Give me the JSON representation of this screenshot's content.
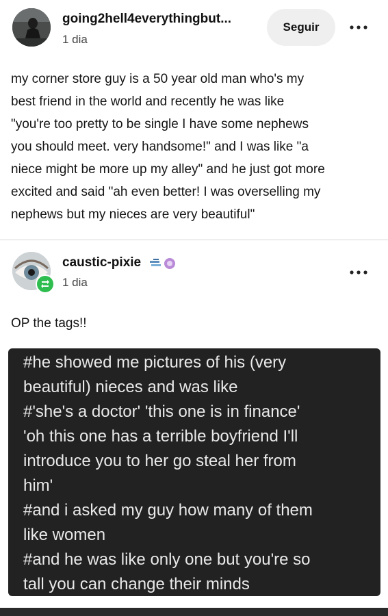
{
  "posts": [
    {
      "username": "going2hell4everythingbut...",
      "time": "1 dia",
      "follow_label": "Seguir",
      "body": "my corner store guy is a 50 year old man who's my\nbest friend in the world and recently he was like\n\"you're too pretty to be single I have some nephews\nyou should meet. very handsome!\" and I was like \"a\nniece might be more up my alley\" and he just got more\nexcited and said \"ah even better! I was overselling my\nnephews but my nieces are very beautiful\""
    },
    {
      "username": "caustic-pixie",
      "time": "1 dia",
      "body": "OP the tags!!",
      "tags": [
        "#he showed me pictures of his (very\nbeautiful) nieces and was like",
        "#'she's a doctor' 'this one is in finance'\n'oh this one has a terrible boyfriend I'll\nintroduce you to her go steal her from\nhim'",
        "#and i asked my guy how many of them\nlike women",
        "#and he was like only one but you're so\ntall you can change their minds"
      ]
    }
  ],
  "icons": {
    "more": "more-options-icon",
    "badges": "blog-badges-icon",
    "reblog": "reblog-icon"
  },
  "colors": {
    "tags_background": "#222222",
    "follow_background": "#efefef",
    "reblog_badge": "#2fbd4f"
  }
}
